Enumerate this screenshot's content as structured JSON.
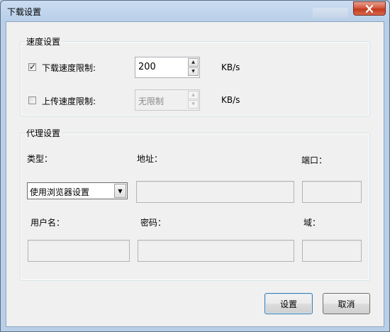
{
  "window": {
    "title": "下载设置"
  },
  "speed_group": {
    "title": "速度设置",
    "download": {
      "checked": true,
      "check_glyph": "✓",
      "label": "下载速度限制:",
      "value": "200",
      "unit": "KB/s"
    },
    "upload": {
      "checked": false,
      "label": "上传速度限制:",
      "value": "无限制",
      "unit": "KB/s"
    }
  },
  "proxy_group": {
    "title": "代理设置",
    "type_label": "类型：",
    "address_label": "地址：",
    "port_label": "端口：",
    "type_value": "使用浏览器设置",
    "username_label": "用户名：",
    "password_label": "密码：",
    "domain_label": "域："
  },
  "buttons": {
    "ok": "设置",
    "cancel": "取消"
  },
  "icons": {
    "close": "close-icon",
    "spin_up": "▲",
    "spin_down": "▼",
    "dropdown": "▼"
  }
}
